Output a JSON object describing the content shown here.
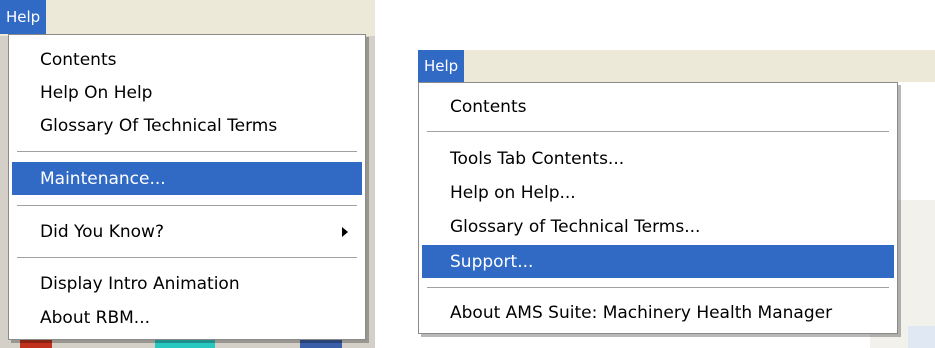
{
  "left_menu": {
    "title": "Help",
    "items": [
      {
        "label": "Contents"
      },
      {
        "label": "Help On Help"
      },
      {
        "label": "Glossary Of Technical Terms"
      },
      {
        "label": "Maintenance..."
      },
      {
        "label": "Did You Know?"
      },
      {
        "label": "Display Intro Animation"
      },
      {
        "label": "About RBM..."
      }
    ],
    "highlighted": "Maintenance..."
  },
  "right_menu": {
    "title": "Help",
    "items": [
      {
        "label": "Contents"
      },
      {
        "label": "Tools Tab Contents..."
      },
      {
        "label": "Help on Help..."
      },
      {
        "label": "Glossary of Technical Terms..."
      },
      {
        "label": "Support..."
      },
      {
        "label": "About AMS Suite: Machinery Health Manager"
      }
    ],
    "highlighted": "Support..."
  },
  "colors": {
    "highlight": "#316ac5",
    "menubar": "#ece9d8",
    "menu_bg": "#ffffff"
  }
}
